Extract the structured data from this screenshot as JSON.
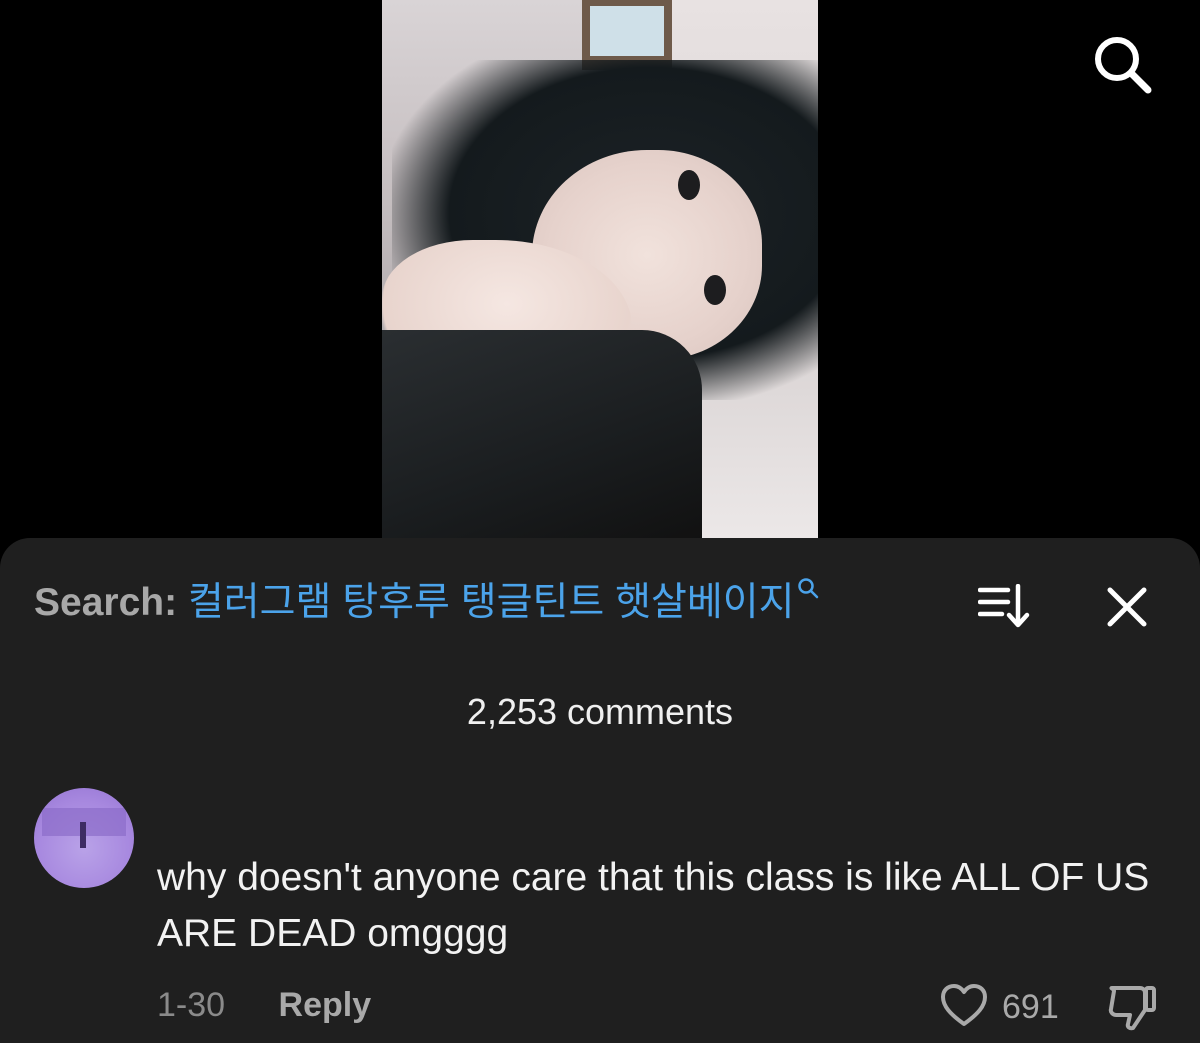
{
  "header": {
    "search_icon": "search-icon"
  },
  "video": {
    "description": ""
  },
  "sheet": {
    "search_label": "Search:",
    "search_query": "컬러그램 탕후루 탱글틴트 햇살베이지",
    "search_mini_icon": "search-icon",
    "sort_icon": "sort-icon",
    "close_icon": "close-icon",
    "comments_count": "2,253 comments"
  },
  "comments": [
    {
      "avatar": "avatar",
      "text": "why doesn't anyone care that this class is like ALL OF US ARE DEAD omgggg",
      "date": "1-30",
      "reply_label": "Reply",
      "like_count": "691",
      "like_icon": "heart-icon",
      "dislike_icon": "thumbs-down-icon"
    }
  ],
  "colors": {
    "sheet_bg": "#1f1f1f",
    "link": "#4ba3ea",
    "muted": "#a8a8a8"
  }
}
